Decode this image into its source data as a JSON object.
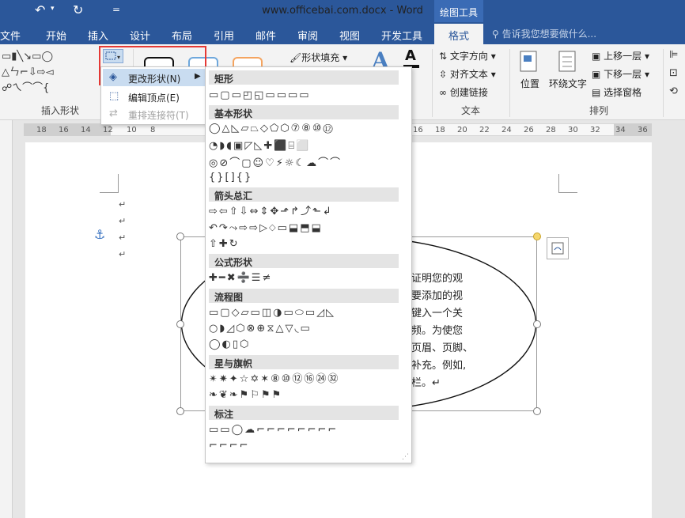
{
  "titlebar": {
    "title": "www.officebai.com.docx - Word",
    "context_group": "绘图工具",
    "qat_undo": "↶",
    "qat_undo_dd": "▾",
    "qat_redo": "↻",
    "qat_more": "="
  },
  "tabs": [
    "文件",
    "开始",
    "插入",
    "设计",
    "布局",
    "引用",
    "邮件",
    "审阅",
    "视图",
    "开发工具"
  ],
  "active_tab": "格式",
  "tell_me": "告诉我您想要做什么...",
  "ribbon": {
    "insert_shapes_group": "插入形状",
    "shape_fill": "形状填充",
    "text_group": "文本",
    "text_direction": "文字方向",
    "align_text": "对齐文本",
    "create_link": "创建链接",
    "position": "位置",
    "wrap_text": "环绕文字",
    "arrange_group": "排列",
    "bring_forward": "上移一层",
    "send_backward": "下移一层",
    "selection_pane": "选择窗格",
    "shapes_row1": "▭▮╲↘▭◯",
    "shapes_row2": "△ㄣ⌐⇩⇨◅",
    "shapes_row3": "☍ㄟ⌒⌒{",
    "text_icon": "A",
    "font_color_icon": "A"
  },
  "ruler": {
    "ticks_left": [
      "18",
      "16",
      "14",
      "12",
      "10",
      "8"
    ],
    "ticks_right": [
      "16",
      "18",
      "20",
      "22",
      "24",
      "26",
      "28",
      "30",
      "32",
      "34",
      "36"
    ]
  },
  "menu": {
    "change_shape": "更改形状(N)",
    "edit_points": "编辑顶点(E)",
    "reroute": "重排连接符(T)"
  },
  "gallery": {
    "categories": [
      {
        "label": "矩形",
        "rows": [
          "▭▢▭◰◱▭▭▭▭"
        ]
      },
      {
        "label": "基本形状",
        "rows": [
          "◯△◺▱⏢◇⬠⬡⑦⑧⑩⑫",
          "◔◗◖▣◸◺✚⬛⌸⬜",
          "◎⊘⌒▢☺♡⚡☼☾☁⌒⌒",
          "{}[]{}"
        ]
      },
      {
        "label": "箭头总汇",
        "rows": [
          "⇨⇦⇧⇩⇔⇕✥⬏↱⤴⬑↲",
          "↶↷⤳⇨⇨▷⬦▭⬓⬒⬓",
          "⇧✚↻"
        ]
      },
      {
        "label": "公式形状",
        "rows": [
          "✚━✖➗☰≠"
        ]
      },
      {
        "label": "流程图",
        "rows": [
          "▭▢◇▱▭◫◑▭⬭▭◿◺",
          "○◗◿⬡⊗⊕⧖△▽◟▭",
          "◯◐▯⬡"
        ]
      },
      {
        "label": "星与旗帜",
        "rows": [
          "✴✷✦☆✡✶⑧⑩⑫⑯㉔㉜",
          "❧❦❧⚑⚐⚑⚑"
        ]
      },
      {
        "label": "标注",
        "rows": [
          "▭▭◯☁⌐⌐⌐⌐⌐⌐⌐⌐",
          "⌐⌐⌐⌐"
        ]
      }
    ]
  },
  "document": {
    "paragraph_mark": "↵",
    "body_lines": [
      "您证明您的观",
      "想要添加的视",
      "以键入一个关",
      "视频。为使您",
      "了页眉、页脚、",
      "为补充。例如,",
      "要栏。↵"
    ]
  },
  "colors": {
    "brand": "#2b579a",
    "highlight": "#c9dcf0",
    "red_box": "#e53935",
    "handle_yellow": "#f5d76e"
  }
}
